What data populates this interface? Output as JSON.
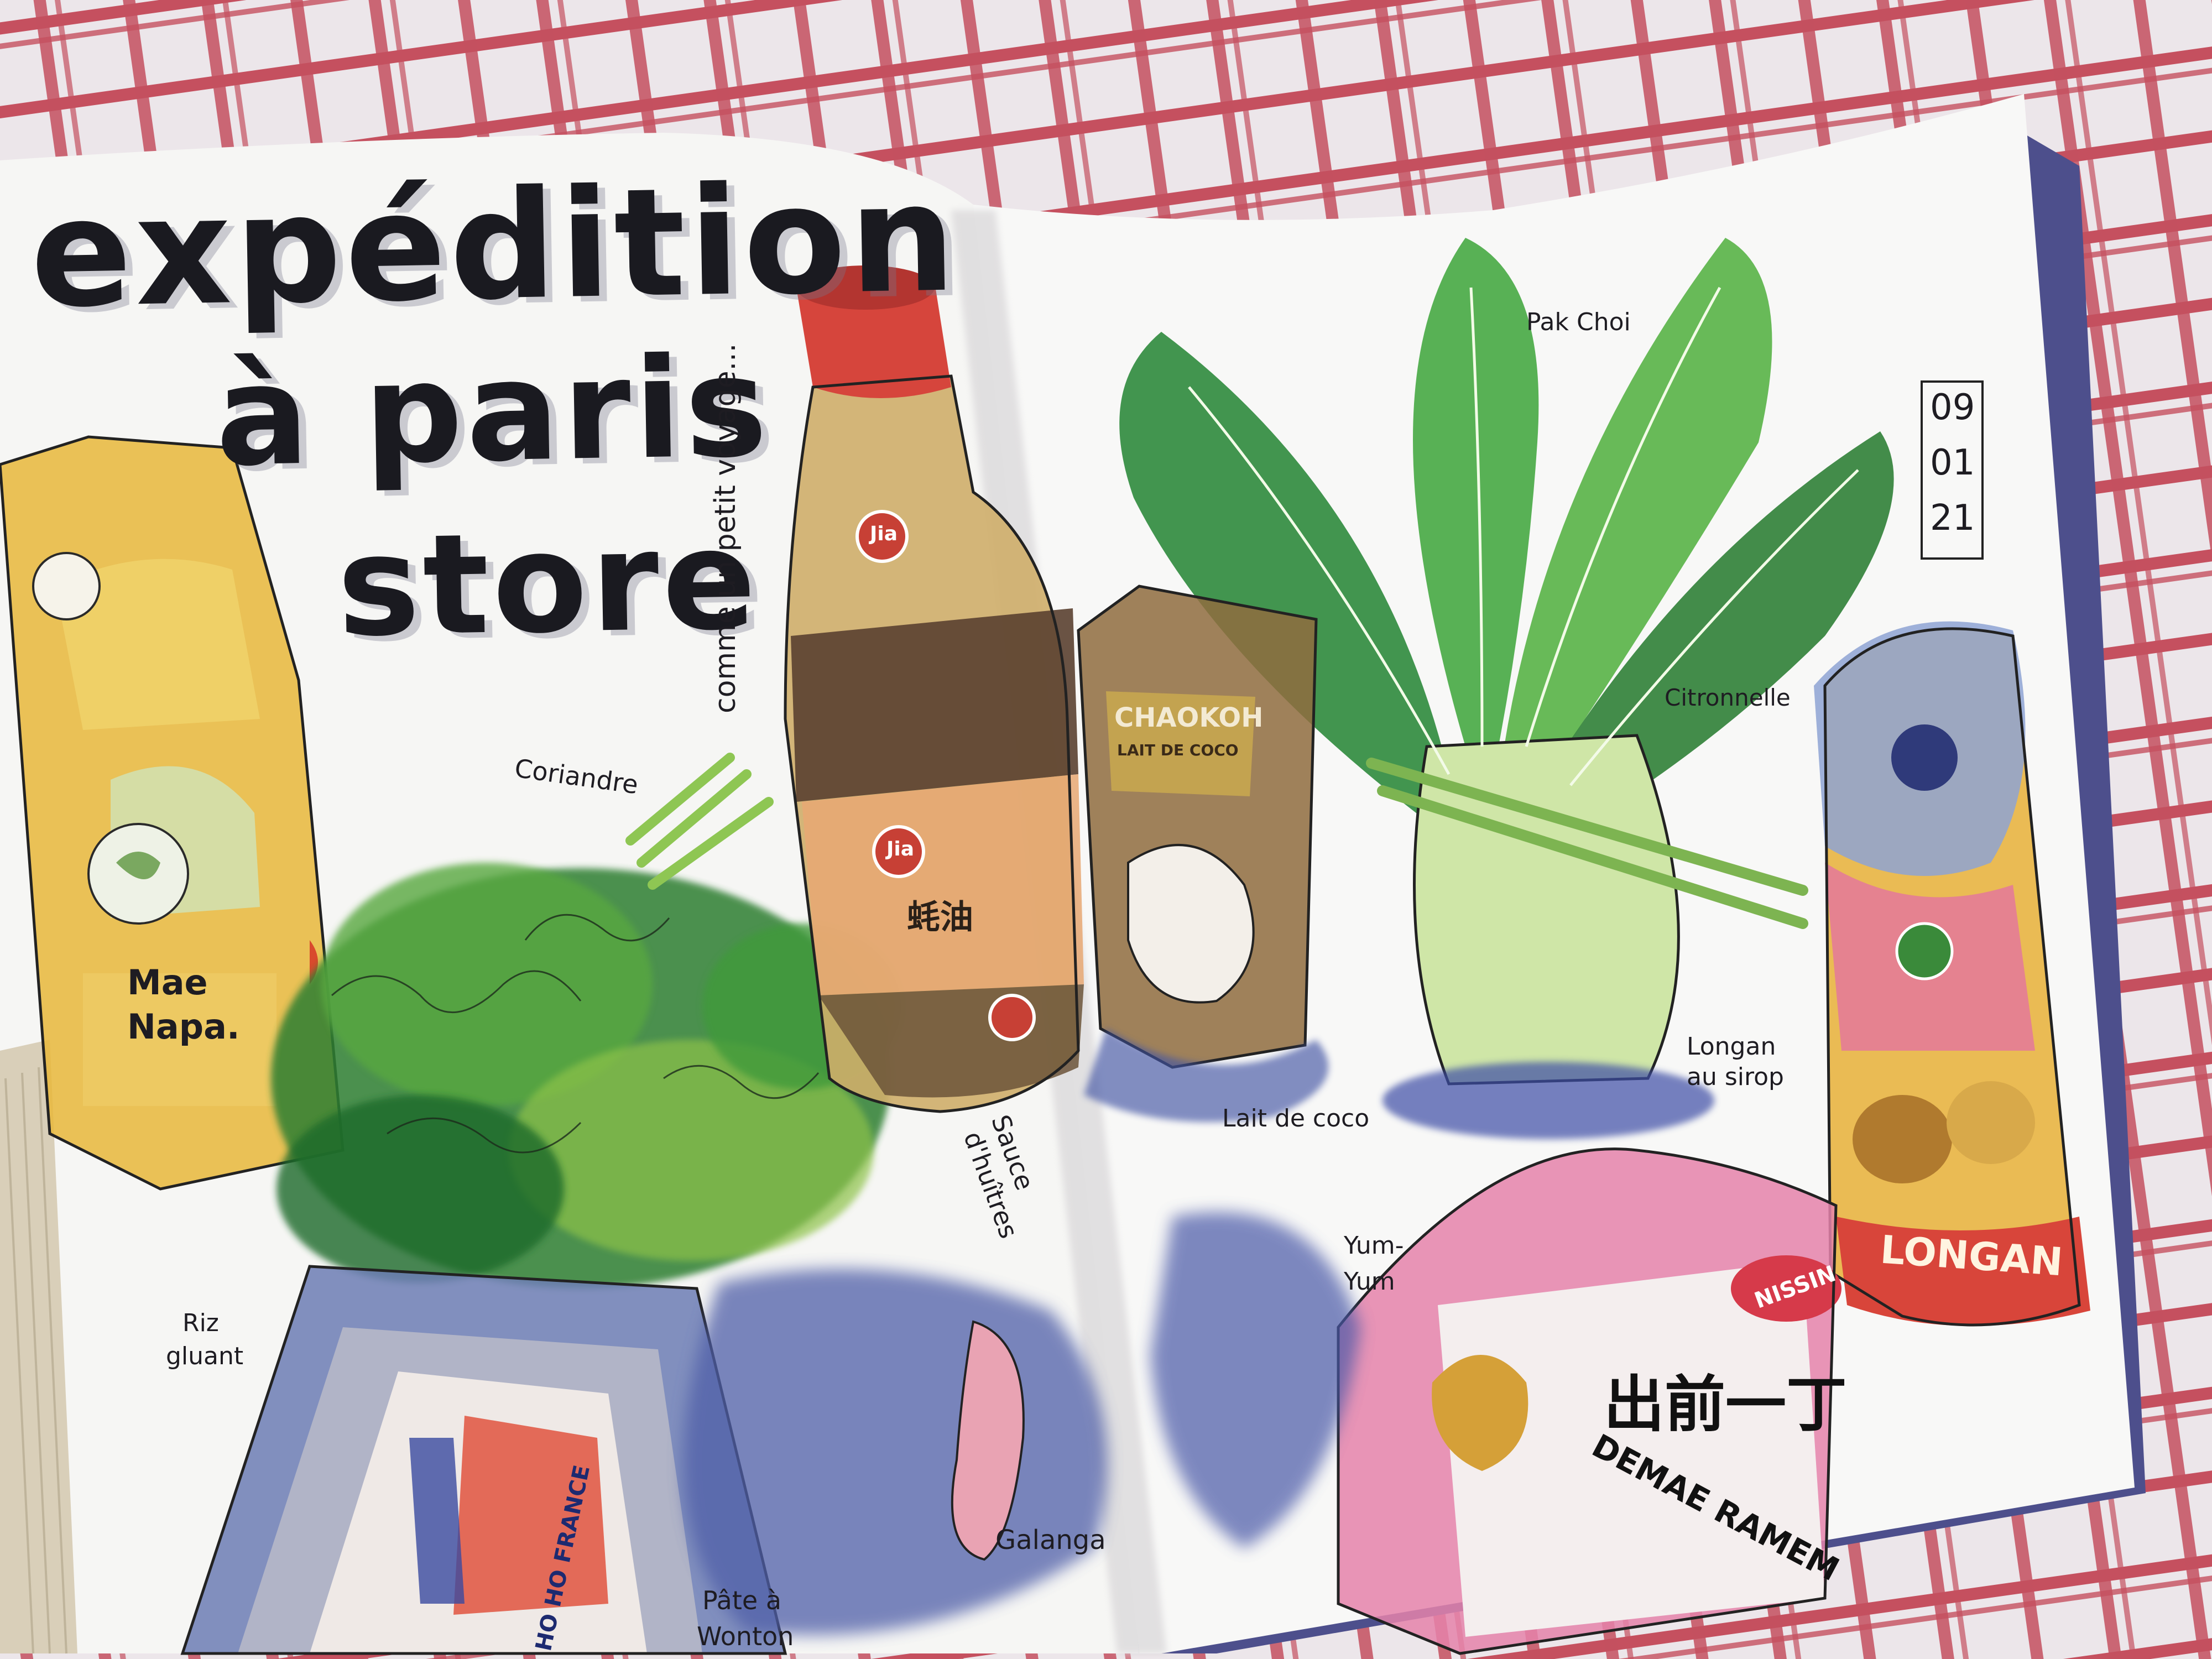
{
  "title": {
    "line1": "expédition",
    "line2": "à paris",
    "line3": "store"
  },
  "subtitle": "comme un petit voyage...",
  "date": {
    "day": "09",
    "month": "01",
    "year": "21"
  },
  "labels": {
    "coriandre": "Coriandre",
    "pak_choi": "Pak Choi",
    "citronnelle": "Citronnelle",
    "lait_de_coco": "Lait de coco",
    "longan_sirop_1": "Longan",
    "longan_sirop_2": "au sirop",
    "sauce_1": "Sauce",
    "sauce_2": "d'huîtres",
    "yum_1": "Yum-",
    "yum_2": "Yum",
    "galanga": "Galanga",
    "pate_1": "Pâte à",
    "pate_2": "Wonton",
    "riz_1": "Riz",
    "riz_2": "gluant"
  },
  "package_text": {
    "mae_napa_1": "Mae",
    "mae_napa_2": "Napa.",
    "chaokoh": "CHAOKOH",
    "lait_coco_pack": "LAIT DE COCO",
    "jia": "Jia",
    "longan_can": "LONGAN",
    "nissin": "NISSIN",
    "demae": "DEMAE RAMEM",
    "ho_ho": "HO HO FRANCE",
    "demae_kanji": "出前一丁",
    "oyster_kanji": "蚝油"
  },
  "colors": {
    "tablecloth_red": "#c5505f",
    "paper": "#f6f6f4",
    "green": "#3f9a3a",
    "navy": "#3e4ea0"
  }
}
